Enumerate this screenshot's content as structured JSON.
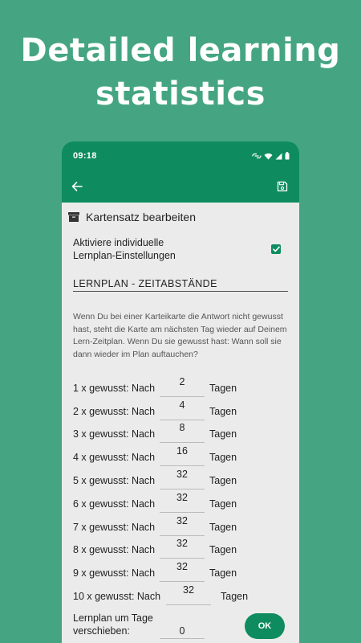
{
  "headline": {
    "line1": "Detailed learning",
    "line2": "statistics"
  },
  "status_bar": {
    "time": "09:18"
  },
  "colors": {
    "background": "#45a583",
    "primary": "#0e8c5f",
    "surface": "#ebebeb"
  },
  "app_bar": {
    "back_icon": "arrow-left-icon",
    "save_icon": "floppy-disk-icon"
  },
  "section": {
    "icon": "archive-box-icon",
    "title": "Kartensatz bearbeiten"
  },
  "individual_settings": {
    "label_line1": "Aktiviere individuelle",
    "label_line2": "Lernplan-Einstellungen",
    "checked": true
  },
  "schedule_heading": "LERNPLAN - ZEITABSTÄNDE",
  "description": "Wenn Du bei einer Karteikarte die Antwort nicht gewusst hast, steht die Karte am nächsten Tag wieder auf Deinem Lern-Zeitplan. Wenn Du sie gewusst hast: Wann soll sie dann wieder im Plan auftauchen?",
  "intervals": [
    {
      "label": "1 x gewusst: Nach",
      "value": "2",
      "unit": "Tagen"
    },
    {
      "label": "2 x gewusst: Nach",
      "value": "4",
      "unit": "Tagen"
    },
    {
      "label": "3 x gewusst: Nach",
      "value": "8",
      "unit": "Tagen"
    },
    {
      "label": "4 x gewusst: Nach",
      "value": "16",
      "unit": "Tagen"
    },
    {
      "label": "5 x gewusst: Nach",
      "value": "32",
      "unit": "Tagen"
    },
    {
      "label": "6 x gewusst: Nach",
      "value": "32",
      "unit": "Tagen"
    },
    {
      "label": "7 x gewusst: Nach",
      "value": "32",
      "unit": "Tagen"
    },
    {
      "label": "8 x gewusst: Nach",
      "value": "32",
      "unit": "Tagen"
    },
    {
      "label": "9 x gewusst: Nach",
      "value": "32",
      "unit": "Tagen"
    },
    {
      "label": "10 x gewusst: Nach",
      "value": "32",
      "unit": "Tagen"
    }
  ],
  "shift": {
    "label_line1": "Lernplan um Tage",
    "label_line2": "verschieben:",
    "value": "0",
    "ok_label": "OK"
  }
}
